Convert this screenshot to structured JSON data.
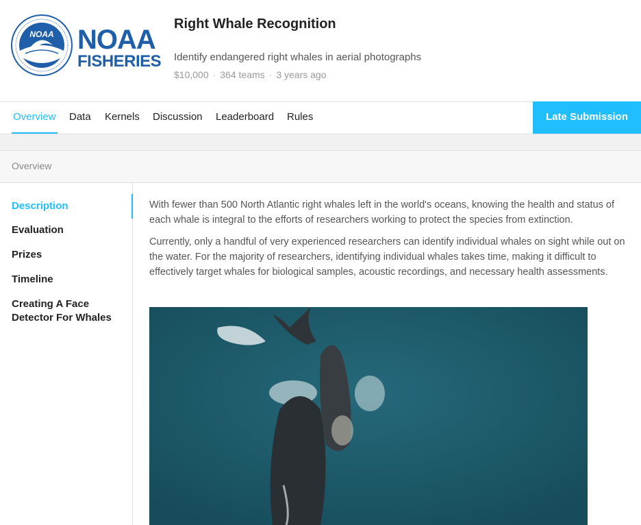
{
  "logo": {
    "line1": "NOAA",
    "line2": "FISHERIES",
    "emblem_text": "NOAA",
    "brand_color": "#1f5ea8"
  },
  "header": {
    "title": "Right Whale Recognition",
    "subtitle": "Identify endangered right whales in aerial photographs",
    "prize": "$10,000",
    "teams": "364 teams",
    "age": "3 years ago",
    "separator": "·"
  },
  "tabs": {
    "overview": "Overview",
    "data": "Data",
    "kernels": "Kernels",
    "discussion": "Discussion",
    "leaderboard": "Leaderboard",
    "rules": "Rules",
    "active": "Overview",
    "late_submission": "Late Submission",
    "accent": "#20beff"
  },
  "section": {
    "label": "Overview"
  },
  "sidebar": {
    "items": [
      {
        "label": "Description"
      },
      {
        "label": "Evaluation"
      },
      {
        "label": "Prizes"
      },
      {
        "label": "Timeline"
      },
      {
        "label": "Creating A Face Detector For Whales"
      }
    ]
  },
  "content": {
    "p1": "With fewer than 500 North Atlantic right whales left in the world's oceans, knowing the health and status of each whale is integral to the efforts of researchers working to protect the species from extinction.",
    "p2": "Currently, only a handful of very experienced researchers can identify individual whales on sight while out on the water. For the majority of researchers, identifying individual whales takes time, making it difficult to effectively target whales for biological samples, acoustic recordings, and necessary health assessments."
  }
}
